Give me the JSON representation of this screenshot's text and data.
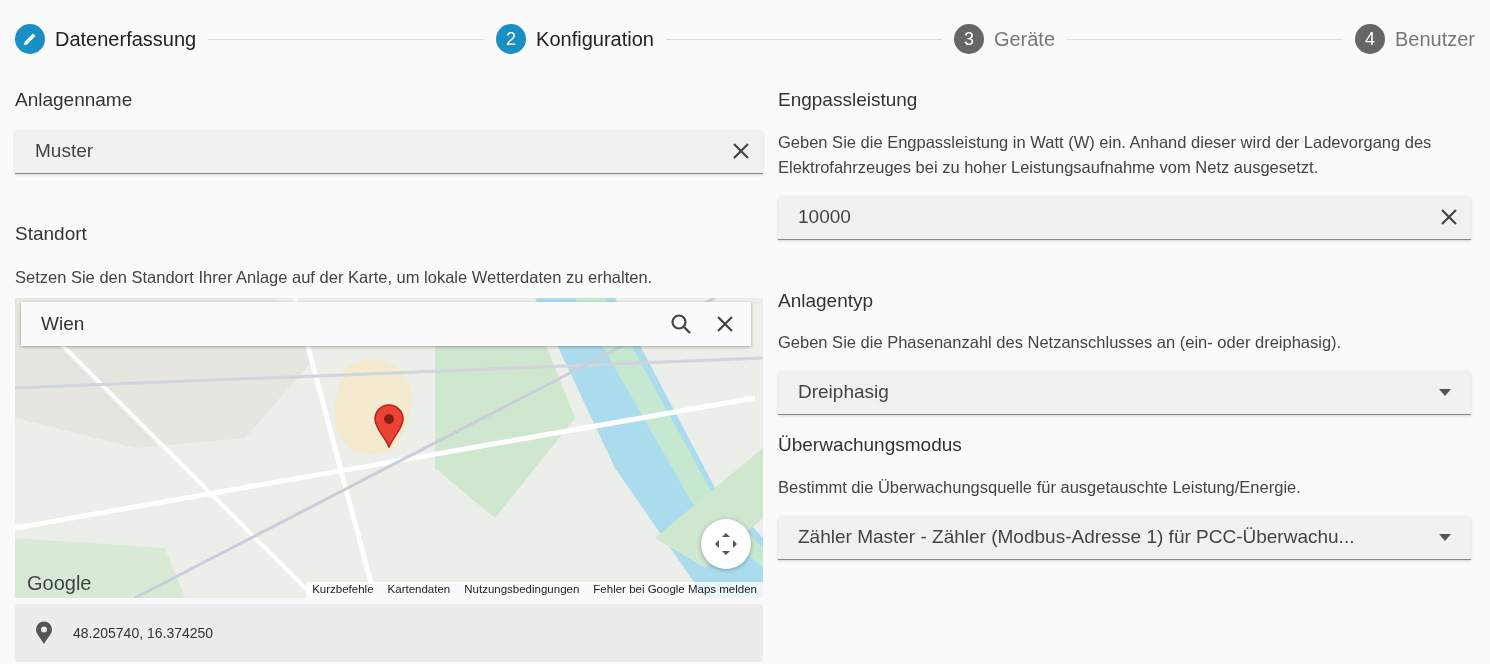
{
  "stepper": [
    {
      "kind": "done",
      "label": "Datenerfassung"
    },
    {
      "kind": "active",
      "number": "2",
      "label": "Konfiguration"
    },
    {
      "kind": "pending",
      "number": "3",
      "label": "Geräte"
    },
    {
      "kind": "pending",
      "number": "4",
      "label": "Benutzer"
    }
  ],
  "plant_name": {
    "label": "Anlagenname",
    "value": "Muster"
  },
  "location": {
    "label": "Standort",
    "description": "Setzen Sie den Standort Ihrer Anlage auf der Karte, um lokale Wetterdaten zu erhalten.",
    "map": {
      "kind": "picture",
      "search_value": "Wien",
      "logo": "Google",
      "attribution": [
        "Kurzbefehle",
        "Kartendaten",
        "Nutzungsbedingungen",
        "Fehler bei Google Maps melden"
      ]
    },
    "coordinates": "48.205740, 16.374250"
  },
  "settings": [
    {
      "label": "Engpassleistung",
      "description": "Geben Sie die Engpassleistung in Watt (W) ein. Anhand dieser wird der Ladevorgang des Elektrofahrzeuges bei zu hoher Leistungsaufnahme vom Netz ausgesetzt.",
      "field": {
        "kind": "text",
        "value": "10000"
      }
    },
    {
      "label": "Anlagentyp",
      "description": "Geben Sie die Phasenanzahl des Netzanschlusses an (ein- oder dreiphasig).",
      "field": {
        "kind": "select",
        "value": "Dreiphasig"
      }
    },
    {
      "label": "Überwachungsmodus",
      "description": "Bestimmt die Überwachungsquelle für ausgetauschte Leistung/Energie.",
      "field": {
        "kind": "select",
        "value": "Zähler Master - Zähler (Modbus-Adresse 1) für PCC-Überwachu..."
      }
    }
  ]
}
